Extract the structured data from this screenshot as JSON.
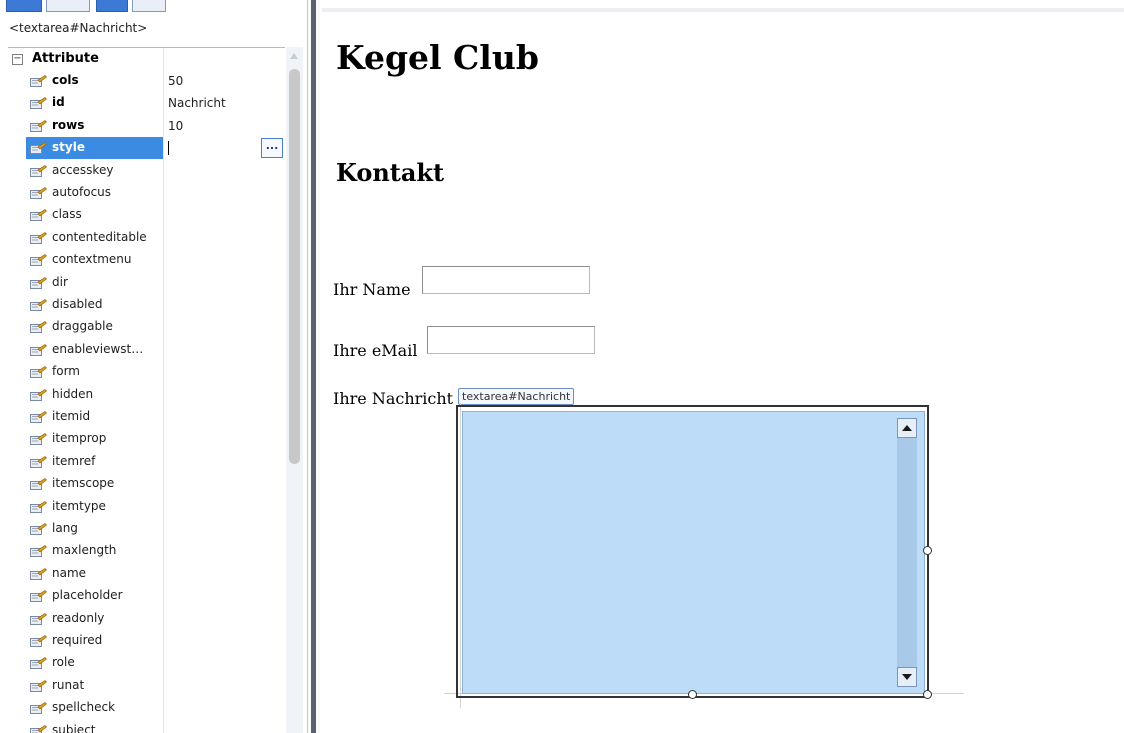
{
  "panel": {
    "element_path": "<textarea#Nachricht>",
    "category": {
      "expander": "−",
      "label": "Attribute"
    },
    "properties": [
      {
        "name": "cols",
        "value": "50"
      },
      {
        "name": "id",
        "value": "Nachricht"
      },
      {
        "name": "rows",
        "value": "10"
      },
      {
        "name": "style",
        "value": ""
      },
      {
        "name": "accesskey",
        "value": ""
      },
      {
        "name": "autofocus",
        "value": ""
      },
      {
        "name": "class",
        "value": ""
      },
      {
        "name": "contenteditable",
        "value": ""
      },
      {
        "name": "contextmenu",
        "value": ""
      },
      {
        "name": "dir",
        "value": ""
      },
      {
        "name": "disabled",
        "value": ""
      },
      {
        "name": "draggable",
        "value": ""
      },
      {
        "name": "enableviewst…",
        "value": ""
      },
      {
        "name": "form",
        "value": ""
      },
      {
        "name": "hidden",
        "value": ""
      },
      {
        "name": "itemid",
        "value": ""
      },
      {
        "name": "itemprop",
        "value": ""
      },
      {
        "name": "itemref",
        "value": ""
      },
      {
        "name": "itemscope",
        "value": ""
      },
      {
        "name": "itemtype",
        "value": ""
      },
      {
        "name": "lang",
        "value": ""
      },
      {
        "name": "maxlength",
        "value": ""
      },
      {
        "name": "name",
        "value": ""
      },
      {
        "name": "placeholder",
        "value": ""
      },
      {
        "name": "readonly",
        "value": ""
      },
      {
        "name": "required",
        "value": ""
      },
      {
        "name": "role",
        "value": ""
      },
      {
        "name": "runat",
        "value": ""
      },
      {
        "name": "spellcheck",
        "value": ""
      },
      {
        "name": "subject",
        "value": ""
      }
    ],
    "selected_property": "style",
    "ellipsis_label": "...",
    "icon": "property-wrench-icon"
  },
  "canvas": {
    "title": "Kegel Club",
    "subtitle": "Kontakt",
    "labels": {
      "name": "Ihr Name",
      "email": "Ihre eMail",
      "message": "Ihre Nachricht"
    },
    "textarea_tag": "textarea#Nachricht"
  },
  "colors": {
    "selection": "#3b8be2",
    "textarea_fill": "#bddcf7",
    "textarea_scroll": "#a9c9e8"
  }
}
